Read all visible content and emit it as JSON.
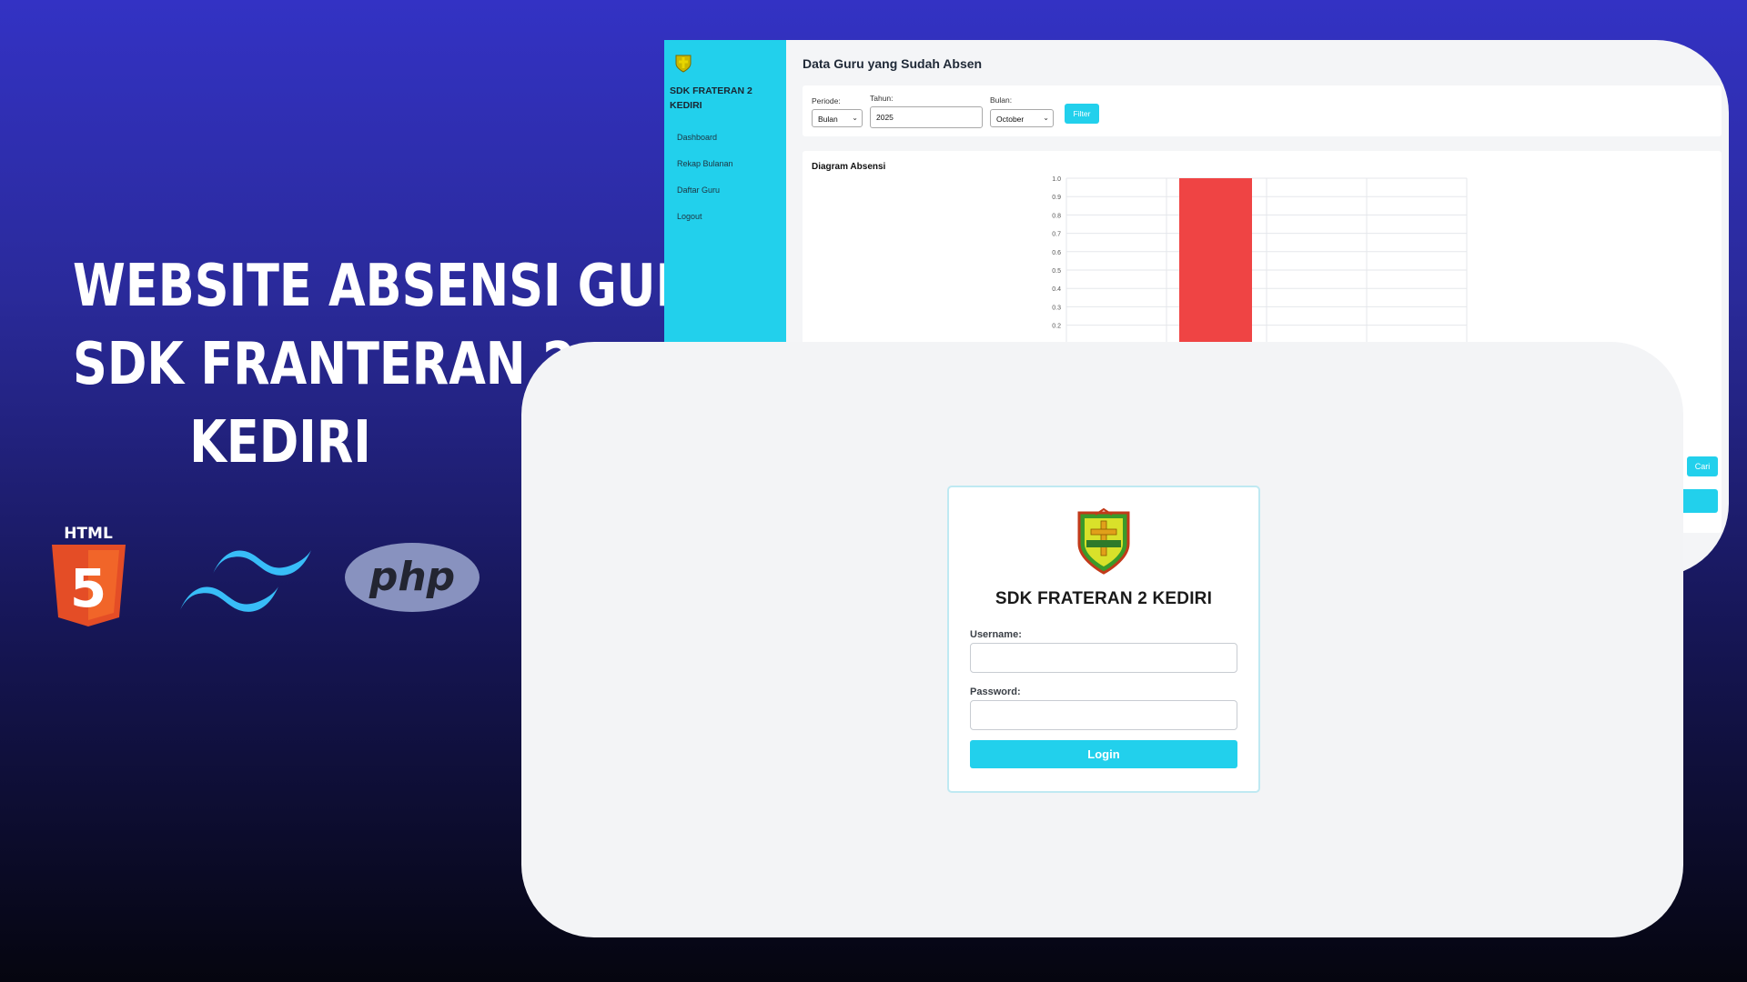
{
  "promo": {
    "headline_lines": [
      "WEBSITE ABSENSI GURU",
      "SDK FRANTERAN 2",
      "KEDIRI"
    ],
    "logos": {
      "html5_label": "HTML",
      "html5_digit": "5",
      "php_label": "php"
    }
  },
  "dashboard": {
    "brand": "SDK FRATERAN 2 KEDIRI",
    "nav": [
      "Dashboard",
      "Rekap Bulanan",
      "Daftar Guru",
      "Logout"
    ],
    "page_title": "Data Guru yang Sudah Absen",
    "filter": {
      "periode_label": "Periode:",
      "periode_value": "Bulan",
      "tahun_label": "Tahun:",
      "tahun_value": "2025",
      "bulan_label": "Bulan:",
      "bulan_value": "October",
      "filter_button": "Filter"
    },
    "chart_title": "Diagram Absensi",
    "side_button": "Cari"
  },
  "chart_data": {
    "type": "bar",
    "title": "Diagram Absensi",
    "y_ticks": [
      "1.0",
      "0.9",
      "0.8",
      "0.7",
      "0.6",
      "0.5",
      "0.4",
      "0.3",
      "0.2"
    ],
    "ylim": [
      0,
      1.0
    ],
    "series": [
      {
        "values": [
          1.0
        ],
        "color": "#ef4444"
      }
    ],
    "grid": true
  },
  "login": {
    "title": "SDK FRATERAN 2 KEDIRI",
    "username_label": "Username:",
    "username_value": "",
    "password_label": "Password:",
    "password_value": "",
    "login_button": "Login",
    "accent_color": "#22d0ec"
  }
}
